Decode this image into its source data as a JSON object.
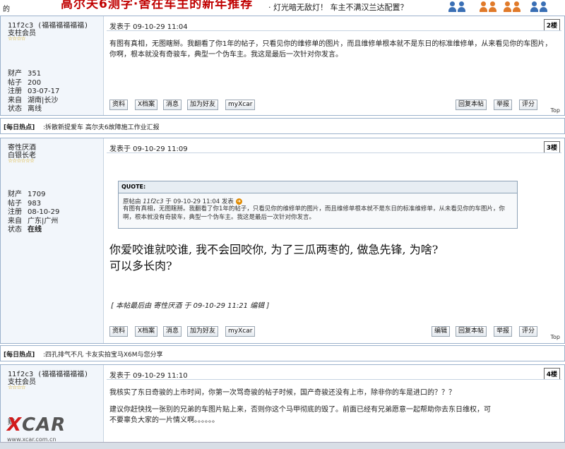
{
  "topbar": {
    "left_text": "的",
    "red_heading": "高尔夫6测字·舍在车主的新年推荐",
    "link": "· 灯光暗无敌灯！ 车主不满汉兰达配置？"
  },
  "posts": [
    {
      "username": "11f2c3 (福福福福福福)",
      "rank": "支柱会员",
      "stars": "☆☆☆☆",
      "stats": [
        {
          "key": "财产",
          "value": "351"
        },
        {
          "key": "帖子",
          "value": "200"
        },
        {
          "key": "注册",
          "value": "03-07-17"
        },
        {
          "key": "来自",
          "value": "湖南|长沙"
        },
        {
          "key": "状态",
          "value": "离线"
        }
      ],
      "post_time": "发表于 09-10-29 11:04",
      "floor": "2楼",
      "content": "有图有真相，无图瞎掰。我翻看了你1年的帖子，只看见你的维修单的图片，而且维修单根本就不是东日的标准维修单，从来看见你的车图片，你啊，根本就没有奇骏车，典型一个伪车主。我这是最后一次针对你发言。",
      "left_buttons": [
        "资料",
        "X档案",
        "消息",
        "加为好友",
        "myXcar"
      ],
      "right_buttons": [
        "回复本帖",
        "举报",
        "评分"
      ],
      "top_label": "Top"
    },
    {
      "username": "寄性厌酒",
      "rank": "白银长老",
      "stars": "☆☆☆☆☆☆",
      "stats": [
        {
          "key": "财产",
          "value": "1709"
        },
        {
          "key": "帖子",
          "value": "983"
        },
        {
          "key": "注册",
          "value": "08-10-29"
        },
        {
          "key": "来自",
          "value": "广东|广州"
        },
        {
          "key": "状态",
          "value": "在线"
        }
      ],
      "post_time": "发表于 09-10-29 11:09",
      "floor": "3楼",
      "quote": {
        "header": "QUOTE:",
        "src_prefix": "原帖由",
        "src_user": "11f2c3",
        "src_suffix": "于 09-10-29 11:04 发表",
        "text": "有图有真相，无图瞎掰。我翻看了你1年的帖子，只看见你的维修单的图片，而且维修单根本就不是东日的标准维修单，从未看见你的车图片，你啊，根本就没有奇骏车，典型一个伪车主。我这是最后一次针对你发言。"
      },
      "content_line1": "你爱咬谁就咬谁, 我不会回咬你, 为了三瓜两枣的, 做急先锋, 为啥?",
      "content_line2": "可以多长肉?",
      "edited": "[ 本帖最后由 寄性厌酒 于 09-10-29 11:21 编辑 ]",
      "left_buttons": [
        "资料",
        "X档案",
        "消息",
        "加为好友",
        "myXcar"
      ],
      "right_buttons": [
        "编辑",
        "回复本帖",
        "举报",
        "评分"
      ],
      "top_label": "Top"
    },
    {
      "username": "11f2c3 (福福福福福福)",
      "rank": "支柱会员",
      "stars": "☆☆☆☆",
      "stats_partial": "财",
      "post_time": "发表于 09-10-29 11:10",
      "floor": "4楼",
      "content_line1": "我核实了东日奇骏的上市时间，你第一次骂奇骏的帖子时候，国产奇骏还没有上市，除非你的车是进口的？？？",
      "content_line2": "建议你赶快找一张别的兄弟的车图片贴上来，否则你这个马甲彻底的毁了。前面已经有兄弟愿意一起帮助你去东日维权，可",
      "content_line3": "不要辜负大家的一片情义啊。。。。。。"
    }
  ],
  "hot_items": [
    {
      "label": "[每日热点]",
      "text": ":拆散新提爱车 高尔夫6故障施工作业汇报"
    },
    {
      "label": "[每日热点]",
      "text": ":四孔排气不凡 卡友实拍宝马X6M与您分享"
    }
  ],
  "watermark": {
    "logo_x": "X",
    "logo_rest": "CAR",
    "url": "www.xcar.com.cn"
  },
  "colors": {
    "border": "#9cb2cc",
    "sidebar_bg": "#f2f6fb",
    "red_heading": "#c00000",
    "user_blue": "#3a6fb5",
    "user_orange": "#e07a2a"
  }
}
